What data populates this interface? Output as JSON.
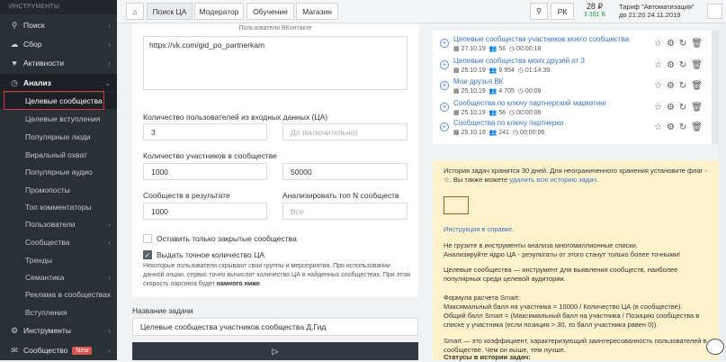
{
  "sidebar": {
    "header": "ИНСТРУМЕНТЫ",
    "items": [
      {
        "label": "Поиск",
        "icon": "search-icon"
      },
      {
        "label": "Сбор",
        "icon": "cloud-icon"
      },
      {
        "label": "Активности",
        "icon": "heart-icon"
      },
      {
        "label": "Анализ",
        "icon": "clock-icon"
      }
    ],
    "sub_items": [
      "Целевые сообщества",
      "Целевые вступления",
      "Популярные люди",
      "Виральный охват",
      "Популярные аудио",
      "Промопосты",
      "Топ комментаторы",
      "Пользователи",
      "Сообщества",
      "Тренды",
      "Семантика",
      "Реклама в сообществах",
      "Вступления"
    ],
    "bottom_items": [
      {
        "label": "Инструменты",
        "icon": "gear-icon"
      },
      {
        "label": "Сообщество",
        "icon": "chat-icon",
        "badge": "New"
      }
    ]
  },
  "topbar": {
    "home_icon": "home-icon",
    "tabs": [
      "Поиск ЦА",
      "Модератор",
      "Обучение",
      "Магазин"
    ],
    "lang": "РК",
    "balance": "28 ₽",
    "bonus": "3 391 В",
    "tariff_line1": "Тариф \"Автоматизация\"",
    "tariff_line2": "до 21:20 24.11.2019"
  },
  "form": {
    "vk_users_caption": "Пользователи ВКонтакте",
    "vk_users_value": "https://vk.com/gid_po_partnerkam",
    "users_count_label": "Количество пользователей из входных данных (ЦА)",
    "users_from": "3",
    "users_to_placeholder": "До (включительно)",
    "members_label": "Количество участников в сообществе",
    "members_from": "1000",
    "members_to": "50000",
    "result_count_label": "Сообществ в результате",
    "result_count": "1000",
    "top_n_label": "Анализировать топ N сообществ",
    "top_n_placeholder": "Все",
    "closed_only_label": "Оставить только закрытые сообщества",
    "exact_count_label": "Выдать точное количество ЦА",
    "note_text": "Некоторые пользователи скрывают свои группы и мероприятия. При использовании данной опции, сервис точно вычислит количество ЦА в найденных сообществах. При этом скорость парсинга будет",
    "note_bold": "намного ниже",
    "note_end": "."
  },
  "task": {
    "label": "Название задачи",
    "value": "Целевые сообщества участников сообщества Д.Гид",
    "run_icon": "play-icon"
  },
  "history": [
    {
      "title": "Целевые сообщества участников моего сообщества",
      "date": "27.10.19",
      "count": "56",
      "time": "00:00:18"
    },
    {
      "title": "Целевые сообщества моих друзей от 3",
      "date": "25.10.19",
      "count": "9 954",
      "time": "01:14:39"
    },
    {
      "title": "Мои друзья ВК",
      "date": "25.10.19",
      "count": "4 705",
      "time": "00:09"
    },
    {
      "title": "Сообщества по ключу партнерский маркетинг",
      "date": "25.10.19",
      "count": "56",
      "time": "00:00:06"
    },
    {
      "title": "Сообщества по ключу партнерки",
      "date": "25.10.19",
      "count": "241",
      "time": "00:00:06"
    }
  ],
  "info": {
    "line1": "История задач хранится 30 дней. Для неограниченного хранения установите флаг -",
    "line2a": "☆. Вы также можете",
    "line2_link": "удалить всю историю задач",
    "line2b": ".",
    "help_link": "Инструкция в справке.",
    "warn1": "Не грузите в инструменты анализа многомиллионные списки.",
    "warn2": "Анализируйте ядро ЦА - результаты от этого станут только более точными!",
    "desc": "Целевые сообщества — инструмент для выявления сообществ, наиболее популярных среди целевой аудитории.",
    "formula_title": "Формула расчета Smart:",
    "formula1": "Максимальный балл на участника = 10000 / Количество ЦА (в сообществе).",
    "formula2": "Общий балл Smart = (Максимальный балл на участника / Позицию сообщества в списке у участника (если позиция > 30, то балл участника равен 0)).",
    "smart_desc": "Smart — это коэффициент, характеризующий заинтересованность пользователей в сообществе. Чем он выше, тем лучше.",
    "statuses": "Статусы в истории задач:"
  }
}
